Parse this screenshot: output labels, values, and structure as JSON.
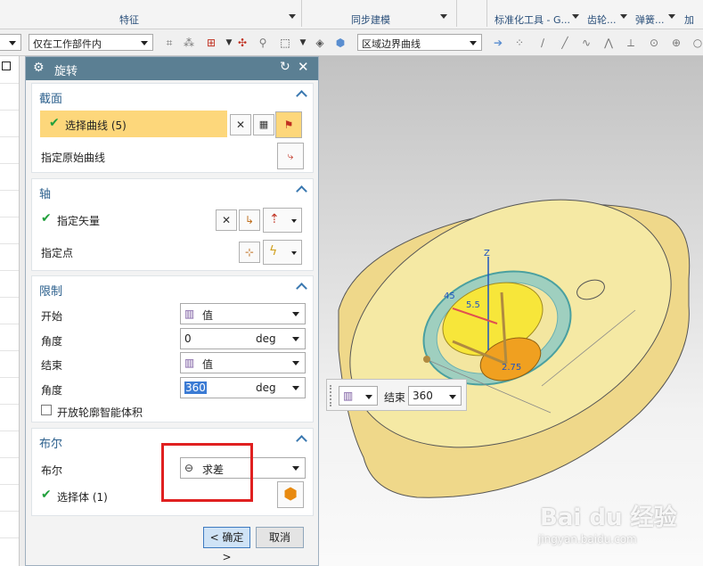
{
  "ribbon": {
    "groups": [
      "特征",
      "同步建模",
      "标准化工具 - G...",
      "齿轮...",
      "弹簧...",
      "加工"
    ]
  },
  "toolbar": {
    "filter_value": "仅在工作部件内",
    "curve_rule_value": "区域边界曲线"
  },
  "dialog": {
    "title": "旋转",
    "sections": {
      "section": {
        "title": "截面",
        "select_curve": "选择曲线 (5)",
        "specify_original_curve": "指定原始曲线"
      },
      "axis": {
        "title": "轴",
        "specify_vector": "指定矢量",
        "specify_point": "指定点"
      },
      "limits": {
        "title": "限制",
        "start_label": "开始",
        "start_mode": "值",
        "start_angle_label": "角度",
        "start_angle_value": "0",
        "start_angle_unit": "deg",
        "end_label": "结束",
        "end_mode": "值",
        "end_angle_label": "角度",
        "end_angle_value": "360",
        "end_angle_unit": "deg",
        "open_profile_label": "开放轮廓智能体积"
      },
      "boolean": {
        "title": "布尔",
        "boolean_label": "布尔",
        "boolean_value": "求差",
        "select_body": "选择体 (1)"
      }
    },
    "ok_label": "< 确定 >",
    "cancel_label": "取消"
  },
  "viewport": {
    "float_toolbar": {
      "end_label": "结束",
      "end_value": "360"
    },
    "dim_labels": [
      "Z",
      "45",
      "5.5",
      "2.75"
    ],
    "watermark": "Bai du 经验",
    "watermark_url": "jingyan.baidu.com"
  }
}
